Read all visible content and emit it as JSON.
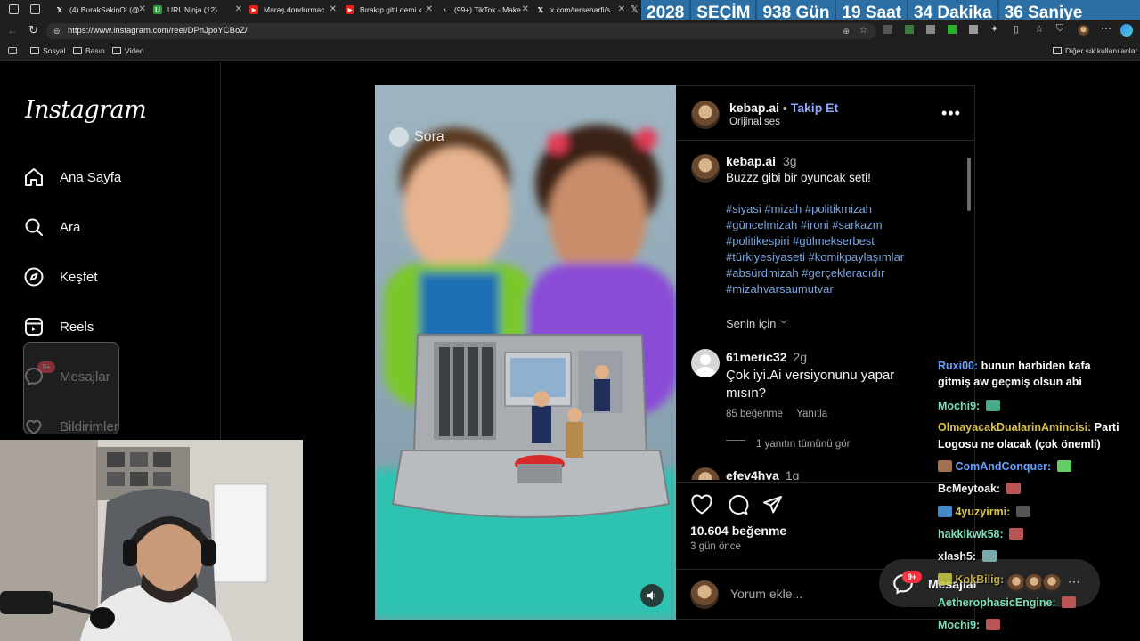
{
  "browser": {
    "tabs": [
      {
        "title": "(4) BurakSakinOl (@",
        "icon": "x-icon"
      },
      {
        "title": "URL Ninja (12)",
        "icon": "url-ninja-icon"
      },
      {
        "title": "Maraş dondurmac",
        "icon": "youtube-icon"
      },
      {
        "title": "Bırakıp gitti demi k",
        "icon": "youtube-icon"
      },
      {
        "title": "(99+) TikTok - Make",
        "icon": "tiktok-icon"
      },
      {
        "title": "x.com/terseharfi/s",
        "icon": "x-icon"
      }
    ],
    "url": "https://www.instagram.com/reel/DPhJpoYCBoZ/",
    "bookmarks": [
      "Sosyal",
      "Basın",
      "Video"
    ],
    "other_bookmarks": "Diğer sık kullanılanlar"
  },
  "countdown": {
    "year": "2028",
    "label": "SEÇİM",
    "days": "938 Gün",
    "hours": "19 Saat",
    "minutes": "34 Dakika",
    "seconds": "36 Saniye",
    "color": "#2b6fa5"
  },
  "sidebar": {
    "logo": "Instagram",
    "items": [
      {
        "label": "Ana Sayfa",
        "icon": "home-icon"
      },
      {
        "label": "Ara",
        "icon": "search-icon"
      },
      {
        "label": "Keşfet",
        "icon": "compass-icon"
      },
      {
        "label": "Reels",
        "icon": "reels-icon"
      },
      {
        "label": "Mesajlar",
        "icon": "messenger-icon",
        "badge": "9+"
      },
      {
        "label": "Bildirimler",
        "icon": "heart-icon"
      }
    ]
  },
  "media": {
    "watermark": "Sora",
    "mute_icon": "speaker-icon"
  },
  "post": {
    "username": "kebap.ai",
    "follow": "Takip Et",
    "separator": "•",
    "audio": "Orijinal ses",
    "caption_user": "kebap.ai",
    "caption_time": "3g",
    "caption": "Buzzz gibi bir oyuncak seti!",
    "hashtags": [
      "#siyasi #mizah #politikmizah",
      "#güncelmizah #ironi #sarkazm",
      "#politikespiri #gülmekserbest",
      "#türkiyesiyaseti #komikpaylaşımlar",
      "#absürdmizah #gerçeklеracıdır",
      "#mizahvarsaumutvar"
    ],
    "for_you": "Senin için",
    "comments": [
      {
        "user": "61meric32",
        "time": "2g",
        "text_line1": "Çok iyi.Ai versiyonunu yapar",
        "text_line2": "mısın?",
        "likes": "85 beğenme",
        "reply": "Yanıtla",
        "view_replies": "1 yanıtın tümünü gör"
      },
      {
        "user": "efev4hya",
        "time": "1g"
      }
    ],
    "likes": "10.604 beğenme",
    "date": "3 gün önce",
    "comment_placeholder": "Yorum ekle..."
  },
  "messages_pill": {
    "label": "Mesajlar",
    "badge": "9+"
  },
  "chat": [
    {
      "user": "Ruxi00:",
      "text": "bunun harbiden kafa",
      "text2": "gitmiş aw geçmiş olsun abi"
    },
    {
      "user": "Mochi9:",
      "text": ""
    },
    {
      "user": "OlmayacakDualarinAmincisi:",
      "text": "Parti",
      "text2": "Logosu ne olacak (çok önemli)"
    },
    {
      "user": "ComAndConquer:",
      "text": ""
    },
    {
      "user": "BcMeytoak:",
      "text": ""
    },
    {
      "user": "4yuzyirmi:",
      "text": ""
    },
    {
      "user": "hakkikwk58:",
      "text": ""
    },
    {
      "user": "xlash5:",
      "text": ""
    },
    {
      "user": "KokBilig:",
      "text": ""
    },
    {
      "user": "AetherophasicEngine:",
      "text": ""
    },
    {
      "user": "Mochi9:",
      "text": ""
    }
  ]
}
